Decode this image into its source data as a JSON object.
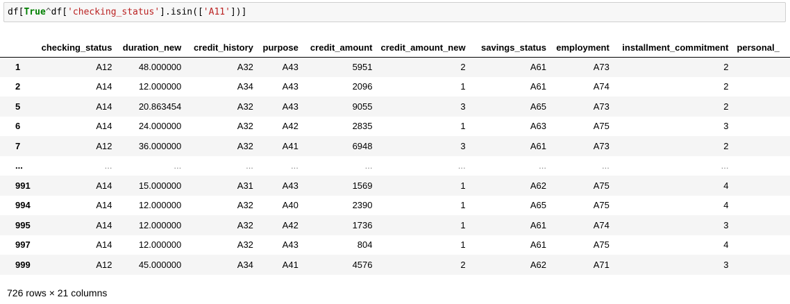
{
  "code": {
    "prefix": "df[",
    "keyword": "True",
    "caret": "^",
    "middle": "df[",
    "string1": "'checking_status'",
    "mid2": "].isin([",
    "string2": "'A11'",
    "suffix": "])]"
  },
  "table": {
    "columns": [
      "checking_status",
      "duration_new",
      "credit_history",
      "purpose",
      "credit_amount",
      "credit_amount_new",
      "savings_status",
      "employment",
      "installment_commitment",
      "personal_"
    ],
    "rows": [
      {
        "index": "1",
        "cells": [
          "A12",
          "48.000000",
          "A32",
          "A43",
          "5951",
          "2",
          "A61",
          "A73",
          "2",
          ""
        ]
      },
      {
        "index": "2",
        "cells": [
          "A14",
          "12.000000",
          "A34",
          "A43",
          "2096",
          "1",
          "A61",
          "A74",
          "2",
          ""
        ]
      },
      {
        "index": "5",
        "cells": [
          "A14",
          "20.863454",
          "A32",
          "A43",
          "9055",
          "3",
          "A65",
          "A73",
          "2",
          ""
        ]
      },
      {
        "index": "6",
        "cells": [
          "A14",
          "24.000000",
          "A32",
          "A42",
          "2835",
          "1",
          "A63",
          "A75",
          "3",
          ""
        ]
      },
      {
        "index": "7",
        "cells": [
          "A12",
          "36.000000",
          "A32",
          "A41",
          "6948",
          "3",
          "A61",
          "A73",
          "2",
          ""
        ]
      },
      {
        "index": "...",
        "cells": [
          "...",
          "...",
          "...",
          "...",
          "...",
          "...",
          "...",
          "...",
          "...",
          ""
        ]
      },
      {
        "index": "991",
        "cells": [
          "A14",
          "15.000000",
          "A31",
          "A43",
          "1569",
          "1",
          "A62",
          "A75",
          "4",
          ""
        ]
      },
      {
        "index": "994",
        "cells": [
          "A14",
          "12.000000",
          "A32",
          "A40",
          "2390",
          "1",
          "A65",
          "A75",
          "4",
          ""
        ]
      },
      {
        "index": "995",
        "cells": [
          "A14",
          "12.000000",
          "A32",
          "A42",
          "1736",
          "1",
          "A61",
          "A74",
          "3",
          ""
        ]
      },
      {
        "index": "997",
        "cells": [
          "A14",
          "12.000000",
          "A32",
          "A43",
          "804",
          "1",
          "A61",
          "A75",
          "4",
          ""
        ]
      },
      {
        "index": "999",
        "cells": [
          "A12",
          "45.000000",
          "A34",
          "A41",
          "4576",
          "2",
          "A62",
          "A71",
          "3",
          ""
        ]
      }
    ]
  },
  "footer": "726 rows × 21 columns"
}
